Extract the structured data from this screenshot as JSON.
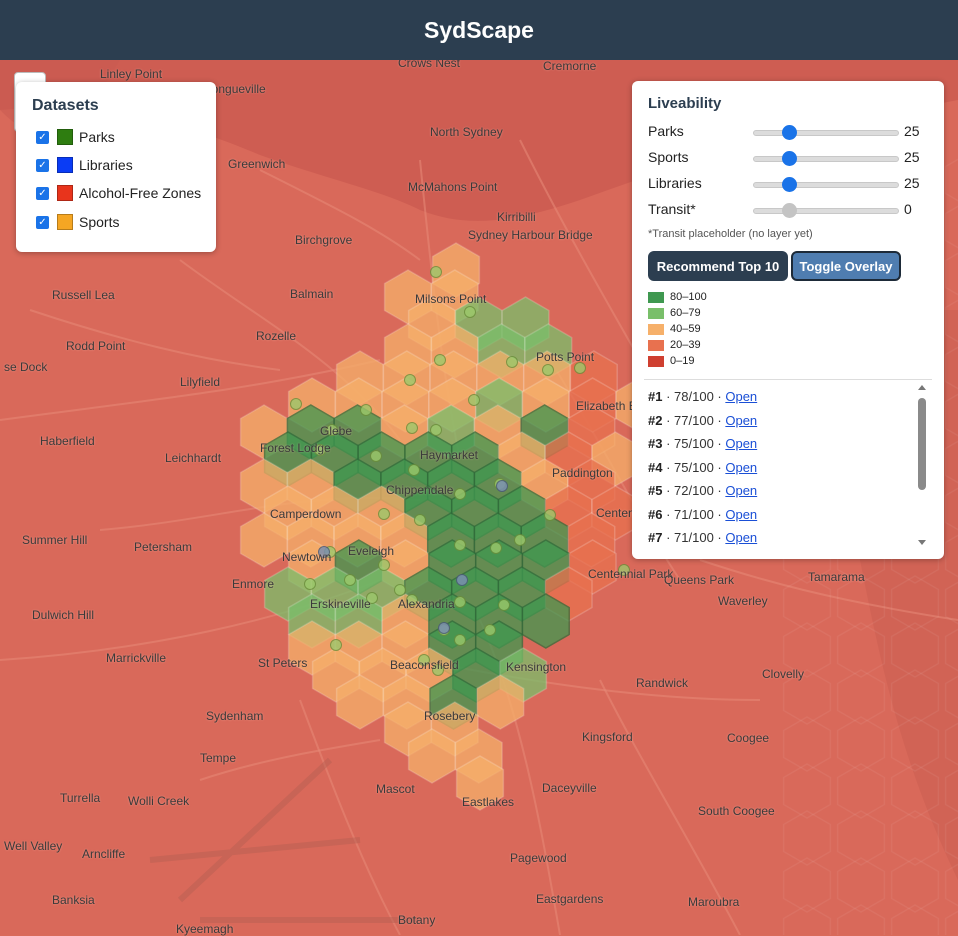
{
  "app": {
    "title": "SydScape"
  },
  "datasets": {
    "title": "Datasets",
    "items": [
      {
        "label": "Parks",
        "color": "#2e7d10",
        "checked": true
      },
      {
        "label": "Libraries",
        "color": "#0a3cf5",
        "checked": true
      },
      {
        "label": "Alcohol-Free Zones",
        "color": "#e8341c",
        "checked": true
      },
      {
        "label": "Sports",
        "color": "#f5a623",
        "checked": true
      }
    ]
  },
  "liveability": {
    "title": "Liveability",
    "sliders": [
      {
        "label": "Parks",
        "value": "25",
        "fraction": 0.25
      },
      {
        "label": "Sports",
        "value": "25",
        "fraction": 0.25
      },
      {
        "label": "Libraries",
        "value": "25",
        "fraction": 0.25
      },
      {
        "label": "Transit*",
        "value": "0",
        "fraction": 0.25,
        "disabled": true
      }
    ],
    "note": "*Transit placeholder (no layer yet)",
    "buttons": {
      "recommend": "Recommend Top 10",
      "toggle": "Toggle Overlay"
    },
    "legend": [
      {
        "range": "80–100",
        "color": "#3f9850"
      },
      {
        "range": "60–79",
        "color": "#79bf6a"
      },
      {
        "range": "40–59",
        "color": "#f6b06a"
      },
      {
        "range": "20–39",
        "color": "#e8714f"
      },
      {
        "range": "0–19",
        "color": "#cf3f30"
      }
    ],
    "rankings": [
      {
        "rank": "#1",
        "score": "78/100",
        "link": "Open"
      },
      {
        "rank": "#2",
        "score": "77/100",
        "link": "Open"
      },
      {
        "rank": "#3",
        "score": "75/100",
        "link": "Open"
      },
      {
        "rank": "#4",
        "score": "75/100",
        "link": "Open"
      },
      {
        "rank": "#5",
        "score": "72/100",
        "link": "Open"
      },
      {
        "rank": "#6",
        "score": "71/100",
        "link": "Open"
      },
      {
        "rank": "#7",
        "score": "71/100",
        "link": "Open"
      }
    ]
  },
  "map": {
    "places": [
      "Linley Point",
      "Crows Nest",
      "Cremorne",
      "Longueville",
      "North Sydney",
      "Greenwich",
      "McMahons Point",
      "Kirribilli",
      "Birchgrove",
      "Sydney Harbour Bridge",
      "Russell Lea",
      "Balmain",
      "Milsons Point",
      "Rozelle",
      "Rodd Point",
      "Potts Point",
      "Lilyfield",
      "se Dock",
      "Haberfield",
      "Leichhardt",
      "Glebe",
      "Forest Lodge",
      "Elizabeth Bay",
      "Haymarket",
      "Chippendale",
      "Paddington",
      "Camperdown",
      "Centennial Square",
      "Summer Hill",
      "Petersham",
      "Newtown",
      "Eveleigh",
      "Centennial Park",
      "Enmore",
      "Queens Park",
      "Tamarama",
      "Dulwich Hill",
      "Erskineville",
      "Waverley",
      "Alexandria",
      "Marrickville",
      "St Peters",
      "Beaconsfield",
      "Kensington",
      "Clovelly",
      "Randwick",
      "Sydenham",
      "Rosebery",
      "Tempe",
      "Kingsford",
      "Coogee",
      "Turrella",
      "Wolli Creek",
      "Mascot",
      "Eastlakes",
      "Daceyville",
      "South Coogee",
      "Arncliffe",
      "Pagewood",
      "Banksia",
      "Eastgardens",
      "Maroubra",
      "Botany",
      "Well Valley",
      "Kyeemagh"
    ]
  }
}
